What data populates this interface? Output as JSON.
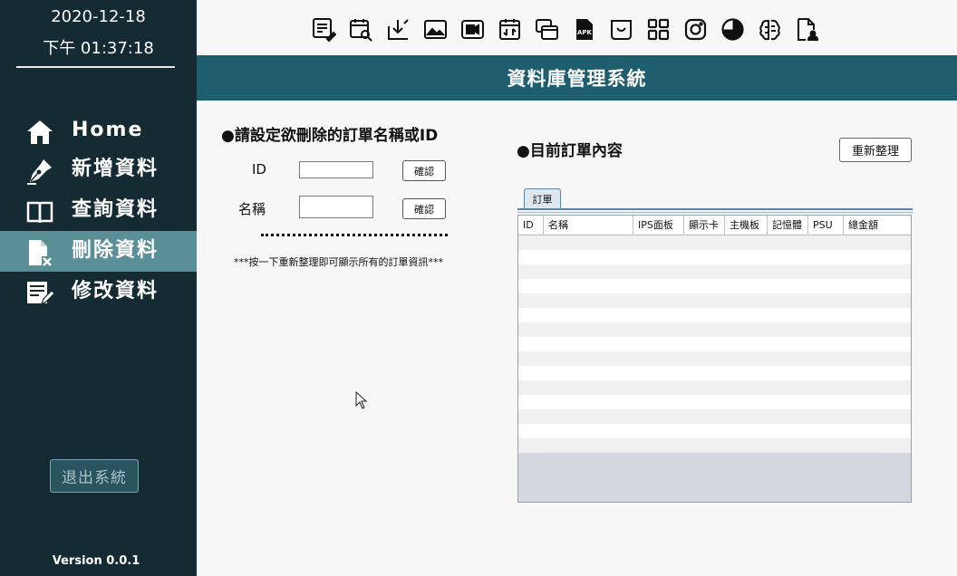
{
  "sidebar": {
    "date": "2020-12-18",
    "time": "下午 01:37:18",
    "items": [
      {
        "label": "Home",
        "icon": "home-icon"
      },
      {
        "label": "新增資料",
        "icon": "pen-nib-icon"
      },
      {
        "label": "查詢資料",
        "icon": "open-book-icon"
      },
      {
        "label": "刪除資料",
        "icon": "file-delete-icon"
      },
      {
        "label": "修改資料",
        "icon": "edit-document-icon"
      }
    ],
    "active_index": 3,
    "exit_label": "退出系統",
    "version": "Version 0.0.1"
  },
  "toolbar": {
    "icons": [
      "list-edit-icon",
      "calendar-search-icon",
      "download-arrow-icon",
      "image-icon",
      "video-camera-icon",
      "calendar-icon",
      "copy-windows-icon",
      "apk-file-icon",
      "inbox-smile-icon",
      "grid-apps-icon",
      "instagram-icon",
      "pie-chart-icon",
      "brain-icon",
      "file-user-icon"
    ],
    "apk_text": "APK"
  },
  "title": "資料庫管理系統",
  "left": {
    "heading": "●請設定欲刪除的訂單名稱或ID",
    "id_label": "ID",
    "id_value": "",
    "id_confirm": "確認",
    "name_label": "名稱",
    "name_value": "",
    "name_confirm": "確認",
    "hint": "***按一下重新整理即可顯示所有的訂單資訊***"
  },
  "right": {
    "heading": "●目前訂單內容",
    "refresh_label": "重新整理",
    "tab_label": "訂單",
    "columns": [
      "ID",
      "名稱",
      "IPS面板",
      "顯示卡",
      "主機板",
      "記憶體",
      "PSU",
      "總金額"
    ]
  },
  "colors": {
    "sidebar_bg": "#142b33",
    "active_item_bg": "#5a8f98",
    "title_bar_bg": "#1f5e6f"
  }
}
